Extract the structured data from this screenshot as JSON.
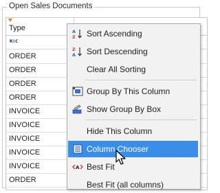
{
  "panel": {
    "title": "Open Sales Documents"
  },
  "grid": {
    "column_header": "Type",
    "filter_text_prefix": "R",
    "filter_text_mid": "B",
    "filter_text_suffix": "C",
    "rows": [
      "ORDER",
      "ORDER",
      "ORDER",
      "ORDER",
      "INVOICE",
      "INVOICE",
      "INVOICE",
      "INVOICE",
      "INVOICE",
      "ORDER"
    ]
  },
  "context_menu": {
    "items": [
      {
        "label": "Sort Ascending",
        "icon": "sort-ascending-icon"
      },
      {
        "label": "Sort Descending",
        "icon": "sort-descending-icon"
      },
      {
        "label": "Clear All Sorting",
        "icon": ""
      },
      {
        "label": "Group By This Column",
        "icon": "group-by-column-icon"
      },
      {
        "label": "Show Group By Box",
        "icon": "group-by-box-icon"
      },
      {
        "label": "Hide This Column",
        "icon": ""
      },
      {
        "label": "Column Chooser",
        "icon": "column-chooser-icon",
        "highlighted": true
      },
      {
        "label": "Best Fit",
        "icon": "best-fit-icon"
      },
      {
        "label": "Best Fit (all columns)",
        "icon": ""
      }
    ]
  },
  "colors": {
    "highlight": "#3b8ee8",
    "filter_icon": "#e07b22",
    "icon_blue": "#1a6fd1",
    "icon_red": "#d9342b"
  }
}
